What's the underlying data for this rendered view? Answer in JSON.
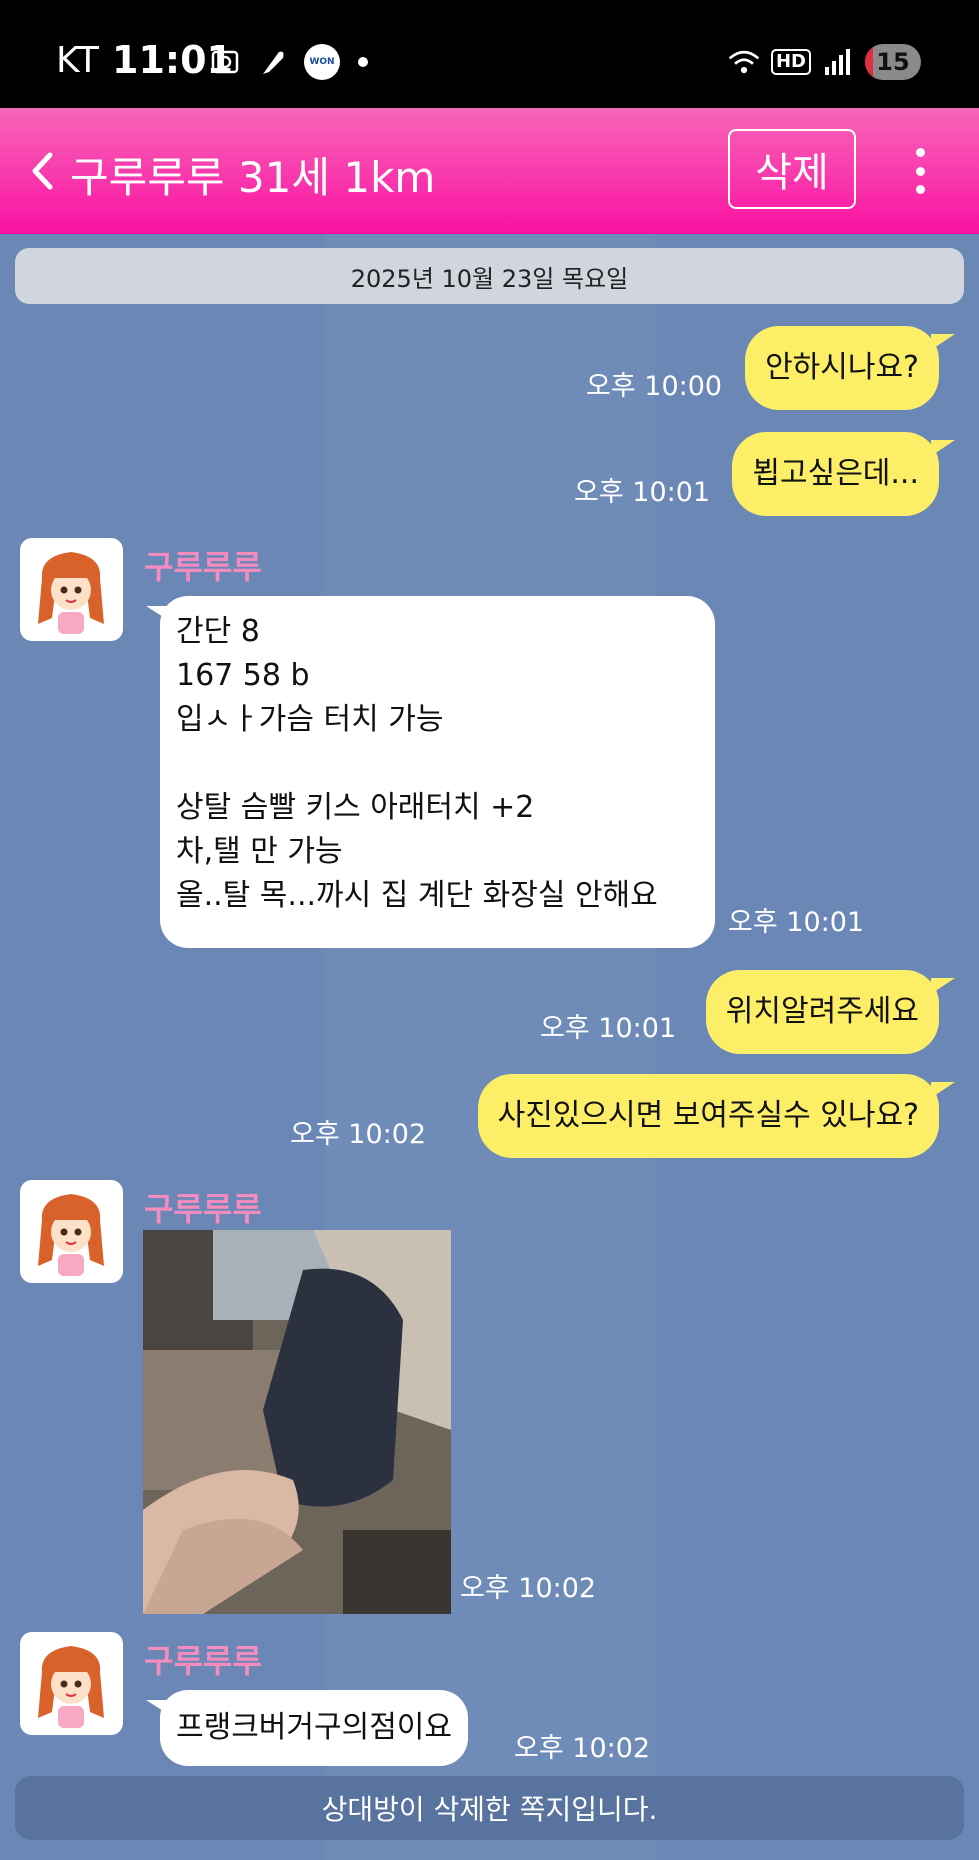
{
  "status_bar": {
    "carrier": "KT",
    "time": "11:01",
    "won_label": "WON",
    "hd_label": "HD",
    "battery": "15",
    "battery_level": 0.15
  },
  "header": {
    "title": "구루루루 31세 1km",
    "delete_label": "삭제",
    "bg_color": "#fb11a2"
  },
  "date_separator": "2025년 10월 23일 목요일",
  "messages": [
    {
      "type": "out",
      "text": "안하시나요?",
      "time": "오후 10:00"
    },
    {
      "type": "out",
      "text": "뵙고싶은데...",
      "time": "오후 10:01"
    },
    {
      "type": "in",
      "sender": "구루루루",
      "lines": [
        "간단 8",
        "167 58 b",
        "입ㅅㅏ가슴 터치 가능",
        "",
        "상탈 슴빨 키스 아래터치 +2",
        "차,탤 만 가능",
        "올..탈 목...까시 집 계단 화장실 안해요"
      ],
      "time": "오후 10:01"
    },
    {
      "type": "out",
      "text": "위치알려주세요",
      "time": "오후 10:01"
    },
    {
      "type": "out",
      "text": "사진있으시면 보여주실수 있나요?",
      "time": "오후 10:02"
    },
    {
      "type": "in",
      "sender": "구루루루",
      "image": true,
      "time": "오후 10:02"
    },
    {
      "type": "in",
      "sender": "구루루루",
      "text": "프랭크버거구의점이요",
      "time": "오후 10:02"
    }
  ],
  "footer_notice": "상대방이 삭제한 쪽지입니다.",
  "colors": {
    "chat_bg": "#6a87b5",
    "out_bubble": "#fcee67",
    "in_bubble": "#ffffff",
    "sender_name": "#f48cbf"
  }
}
